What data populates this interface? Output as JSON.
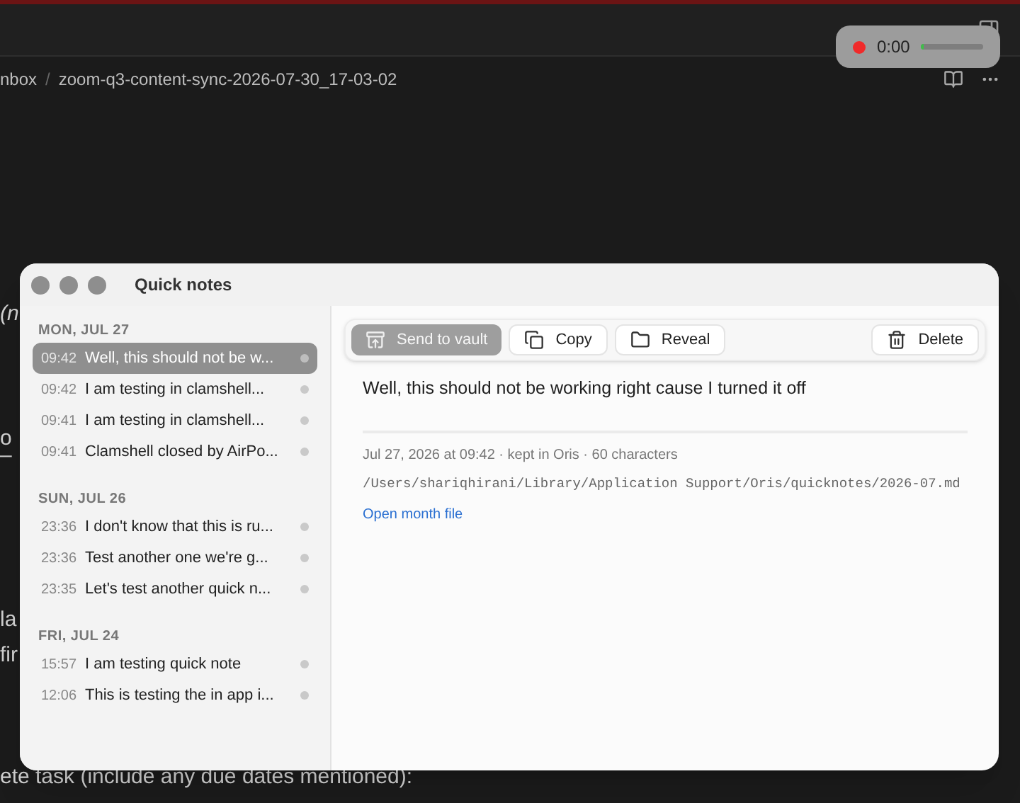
{
  "app": {
    "breadcrumb": [
      {
        "label": "nbox"
      },
      {
        "label": "zoom-q3-content-sync-2026-07-30_17-03-02"
      }
    ],
    "breadcrumb_separator": "/",
    "background_lines": [
      {
        "text": "(n",
        "italic": true
      },
      {
        "text": "o",
        "italic": false
      },
      {
        "text": "–",
        "italic": false
      },
      {
        "text": "la",
        "italic": false
      },
      {
        "text": "fir",
        "italic": false
      },
      {
        "text": "ete task (include any due dates mentioned):",
        "italic": false
      }
    ]
  },
  "recorder": {
    "time": "0:00",
    "level": 0.04
  },
  "window": {
    "title": "Quick notes"
  },
  "groups": [
    {
      "date": "MON, JUL 27",
      "notes": [
        {
          "time": "09:42",
          "text": "Well, this should not be w...",
          "selected": true
        },
        {
          "time": "09:42",
          "text": "I am testing in clamshell...",
          "selected": false
        },
        {
          "time": "09:41",
          "text": "I am testing in clamshell...",
          "selected": false
        },
        {
          "time": "09:41",
          "text": "Clamshell closed by AirPo...",
          "selected": false
        }
      ]
    },
    {
      "date": "SUN, JUL 26",
      "notes": [
        {
          "time": "23:36",
          "text": "I don't know that this is ru...",
          "selected": false
        },
        {
          "time": "23:36",
          "text": "Test another one we're g...",
          "selected": false
        },
        {
          "time": "23:35",
          "text": "Let's test another quick n...",
          "selected": false
        }
      ]
    },
    {
      "date": "FRI, JUL 24",
      "notes": [
        {
          "time": "15:57",
          "text": "I am testing quick note",
          "selected": false
        },
        {
          "time": "12:06",
          "text": "This is testing the in app i...",
          "selected": false
        }
      ]
    }
  ],
  "toolbar": [
    {
      "label": "Send to vault",
      "kind": "vault",
      "disabled": true
    },
    {
      "label": "Copy",
      "kind": "copy",
      "disabled": false
    },
    {
      "label": "Reveal",
      "kind": "reveal",
      "disabled": false
    },
    {
      "label": "Delete",
      "kind": "delete",
      "disabled": false
    }
  ],
  "note": {
    "text": "Well, this should not be working right cause I turned it off",
    "meta": "Jul 27, 2026 at 09:42 · kept in Oris · 60 characters",
    "path": "/Users/shariqhirani/Library/Application Support/Oris/quicknotes/2026-07.md",
    "link": "Open month file"
  }
}
